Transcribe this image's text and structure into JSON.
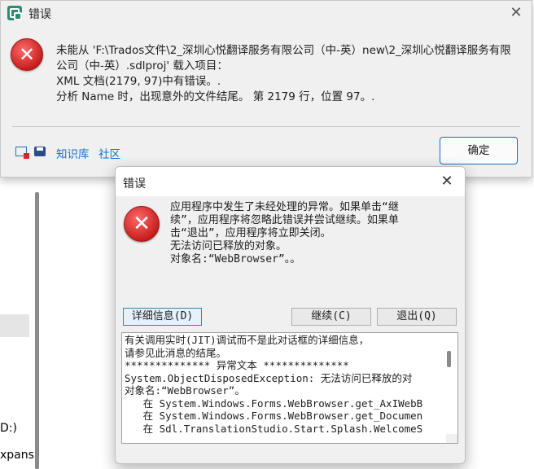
{
  "background": {
    "left_labels": [
      "D:)",
      "xpans"
    ]
  },
  "dialog1": {
    "title": "错误",
    "message_lines": [
      "未能从 'F:\\Trados文件\\2_深圳心悦翻译服务有限公司（中-英）new\\2_深圳心悦翻译服务有限",
      "公司（中-英）.sdlproj' 载入项目：",
      "XML 文档(2179, 97)中有错误。.",
      "分析 Name 时，出现意外的文件结尾。 第 2179 行，位置 97。."
    ],
    "footer_links": [
      "知识库",
      "社区"
    ],
    "ok_label": "确定",
    "icons": [
      "app-icon",
      "error-icon",
      "copy-details-icon",
      "save-icon",
      "close-icon"
    ],
    "error_color": "#d32020",
    "link_color": "#1a6fc0",
    "accent": "#0f6cbd"
  },
  "dialog2": {
    "title": "错误",
    "message_lines": [
      "应用程序中发生了未经处理的异常。如果单击“继",
      "续”，应用程序将忽略此错误并尝试继续。如果单",
      "击“退出”，应用程序将立即关闭。",
      "",
      "无法访问已释放的对象。",
      "对象名:“WebBrowser”。。"
    ],
    "details_label": "详细信息(D)",
    "continue_label": "继续(C)",
    "quit_label": "退出(Q)",
    "detail_lines": [
      "有关调用实时(JIT)调试而不是此对话框的详细信息，",
      "请参见此消息的结尾。",
      "",
      "************** 异常文本 **************",
      "System.ObjectDisposedException: 无法访问已释放的对",
      "对象名:“WebBrowser”。",
      "   在 System.Windows.Forms.WebBrowser.get_AxIWebB",
      "   在 System.Windows.Forms.WebBrowser.get_Documen",
      "   在 Sdl.TranslationStudio.Start.Splash.WelcomeS"
    ],
    "icons": [
      "error-icon",
      "close-icon"
    ]
  }
}
